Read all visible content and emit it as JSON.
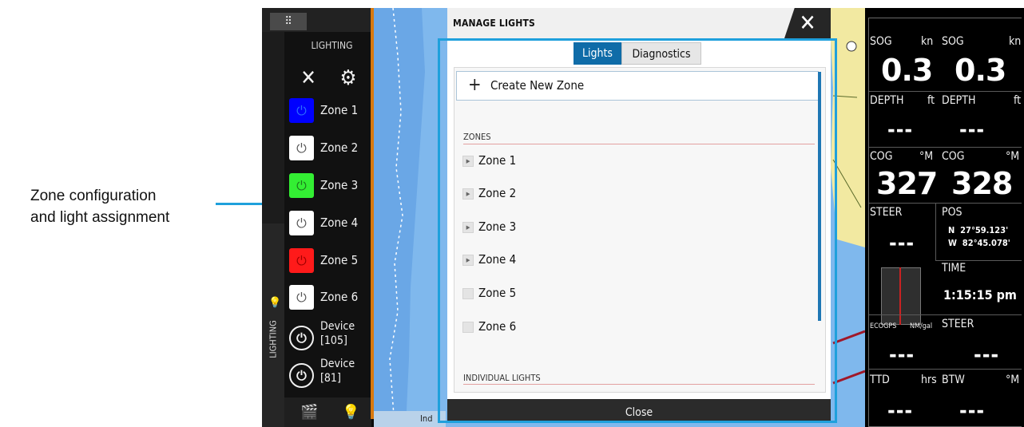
{
  "callout": {
    "line1": "Zone configuration",
    "line2": "and light assignment"
  },
  "lighting_panel": {
    "title": "LIGHTING",
    "vertical_label": "LIGHTING",
    "zones": [
      {
        "label": "Zone 1",
        "color": "#0000ff",
        "icon_color": "#2a6cff"
      },
      {
        "label": "Zone 2",
        "color": "#ffffff",
        "icon_color": "#555555"
      },
      {
        "label": "Zone 3",
        "color": "#33ee33",
        "icon_color": "#1d7a1d"
      },
      {
        "label": "Zone 4",
        "color": "#ffffff",
        "icon_color": "#555555"
      },
      {
        "label": "Zone 5",
        "color": "#ff1a1a",
        "icon_color": "#a00000"
      },
      {
        "label": "Zone 6",
        "color": "#ffffff",
        "icon_color": "#555555"
      }
    ],
    "devices": [
      {
        "line1": "Device",
        "line2": "[105]"
      },
      {
        "line1": "Device",
        "line2": "[81]"
      }
    ]
  },
  "chart": {
    "bottom_label": "Ind"
  },
  "dialog": {
    "title": "MANAGE LIGHTS",
    "tabs": {
      "lights": "Lights",
      "diagnostics": "Diagnostics",
      "active": "lights"
    },
    "create_label": "Create New Zone",
    "zones_header": "ZONES",
    "zones": [
      "Zone 1",
      "Zone 2",
      "Zone 3",
      "Zone 4",
      "Zone 5",
      "Zone 6"
    ],
    "individual_header": "INDIVIDUAL LIGHTS",
    "close_label": "Close"
  },
  "instruments": {
    "sog1": {
      "label": "SOG",
      "unit": "kn",
      "value": "0.3"
    },
    "sog2": {
      "label": "SOG",
      "unit": "kn",
      "value": "0.3"
    },
    "depth1": {
      "label": "DEPTH",
      "unit": "ft",
      "value": "---"
    },
    "depth2": {
      "label": "DEPTH",
      "unit": "ft",
      "value": "---"
    },
    "cog1": {
      "label": "COG",
      "unit": "°M",
      "value": "327"
    },
    "cog2": {
      "label": "COG",
      "unit": "°M",
      "value": "328"
    },
    "steer1": {
      "label": "STEER",
      "value": "---"
    },
    "pos": {
      "label": "POS",
      "lat": "N  27°59.123'",
      "lon": "W  82°45.078'"
    },
    "time": {
      "label": "TIME",
      "value": "1:15:15 pm"
    },
    "eco": {
      "label": "ECOGPS",
      "unit": "NM/gal"
    },
    "steer2": {
      "label": "STEER",
      "value": "---"
    },
    "eco_value": "---",
    "ttd": {
      "label": "TTD",
      "unit": "hrs",
      "value": "---"
    },
    "btw": {
      "label": "BTW",
      "unit": "°M",
      "value": "---"
    }
  }
}
